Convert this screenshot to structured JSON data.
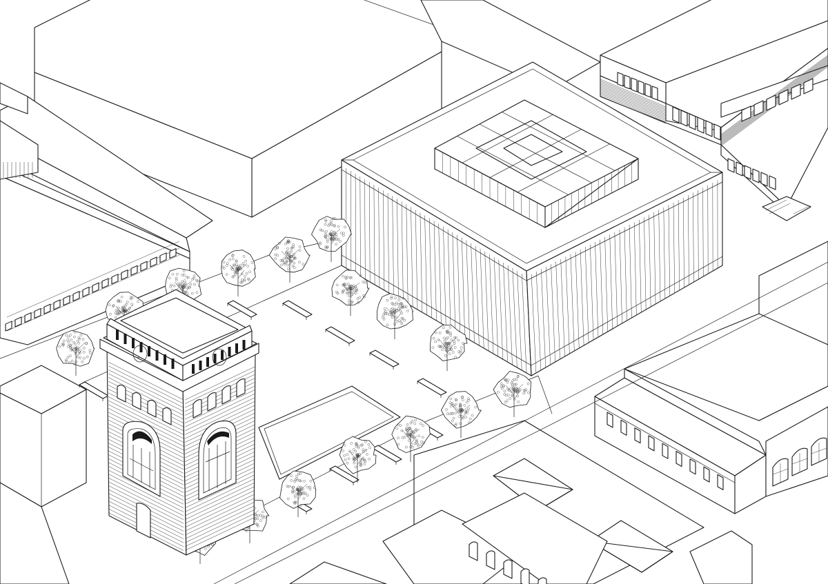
{
  "drawing": {
    "type": "axonometric-line-drawing",
    "colors": {
      "ink": "#1a1a1a",
      "paper": "#ffffff"
    },
    "elements": [
      "water-tower",
      "library-cube",
      "courtyard-pavilion",
      "plaza-trees",
      "plaza-benches",
      "reflecting-pool",
      "warehouse-left",
      "industrial-hall-right",
      "depot-building",
      "context-blocks"
    ]
  }
}
